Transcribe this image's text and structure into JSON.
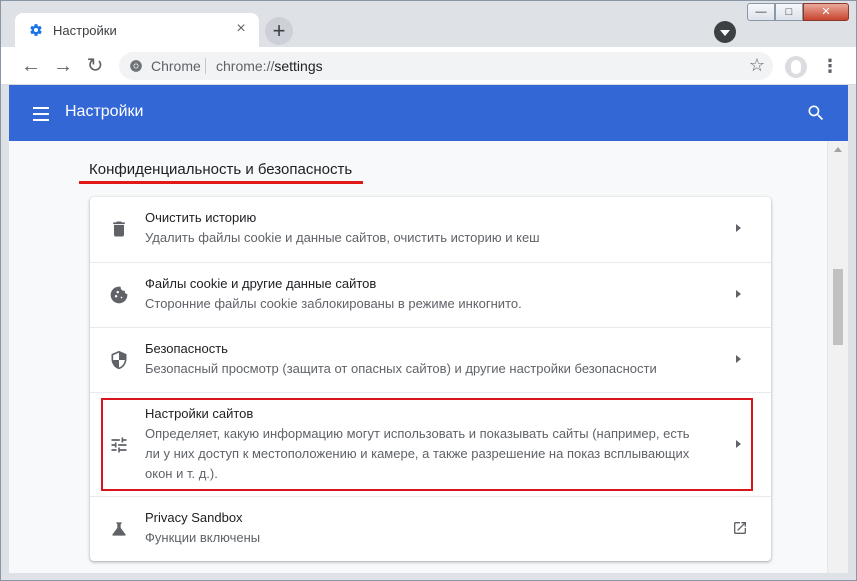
{
  "tab": {
    "title": "Настройки",
    "close": "×",
    "new_tab": "+"
  },
  "window_controls": {
    "minimize": "—",
    "maximize": "□",
    "close": "✕"
  },
  "toolbar": {
    "back": "←",
    "forward": "→",
    "reload": "↻",
    "site_label": "Chrome",
    "url_scheme": "chrome://",
    "url_path": "settings",
    "bookmark": "☆",
    "menu": "⋮"
  },
  "header": {
    "title": "Настройки"
  },
  "section": {
    "title": "Конфиденциальность и безопасность"
  },
  "rows": [
    {
      "icon": "trash-icon",
      "title": "Очистить историю",
      "subtitle": "Удалить файлы cookie и данные сайтов, очистить историю и кеш"
    },
    {
      "icon": "cookie-icon",
      "title": "Файлы cookie и другие данные сайтов",
      "subtitle": "Сторонние файлы cookie заблокированы в режиме инкогнито."
    },
    {
      "icon": "shield-icon",
      "title": "Безопасность",
      "subtitle": "Безопасный просмотр (защита от опасных сайтов) и другие настройки безопасности"
    },
    {
      "icon": "tune-icon",
      "title": "Настройки сайтов",
      "subtitle": "Определяет, какую информацию могут использовать и показывать сайты (например, есть ли у них доступ к местоположению и камере, а также разрешение на показ всплывающих окон и т. д.)."
    },
    {
      "icon": "flask-icon",
      "title": "Privacy Sandbox",
      "subtitle": "Функции включены"
    }
  ],
  "colors": {
    "header": "#3367d6",
    "highlight": "#d8141c"
  }
}
